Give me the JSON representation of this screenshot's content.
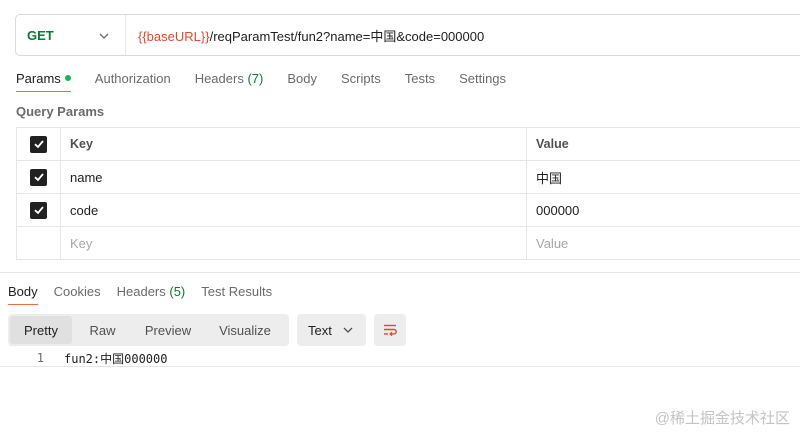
{
  "request": {
    "method": "GET",
    "url_var": "{{baseURL}}",
    "url_rest": "/reqParamTest/fun2?name=中国&code=000000"
  },
  "request_tabs": [
    {
      "label": "Params",
      "active": true,
      "dot": true
    },
    {
      "label": "Authorization"
    },
    {
      "label": "Headers",
      "count": "(7)"
    },
    {
      "label": "Body"
    },
    {
      "label": "Scripts"
    },
    {
      "label": "Tests"
    },
    {
      "label": "Settings"
    }
  ],
  "query_params": {
    "title": "Query Params",
    "header": {
      "key": "Key",
      "value": "Value"
    },
    "rows": [
      {
        "key": "name",
        "value": "中国",
        "checked": true
      },
      {
        "key": "code",
        "value": "000000",
        "checked": true
      }
    ],
    "placeholder": {
      "key": "Key",
      "value": "Value"
    }
  },
  "response_tabs": [
    {
      "label": "Body",
      "active": true
    },
    {
      "label": "Cookies"
    },
    {
      "label": "Headers",
      "count": "(5)"
    },
    {
      "label": "Test Results"
    }
  ],
  "view_modes": [
    "Pretty",
    "Raw",
    "Preview",
    "Visualize"
  ],
  "active_view": "Pretty",
  "format_select": "Text",
  "wrap_icon": "wrap-lines-icon",
  "response_body": {
    "line_number": "1",
    "text": "fun2:中国000000"
  },
  "watermark": "@稀土掘金技术社区",
  "colors": {
    "method": "#0a7a38",
    "url_var": "#e2492d",
    "accent": "#f26b3a",
    "dot": "#0cbb52"
  }
}
